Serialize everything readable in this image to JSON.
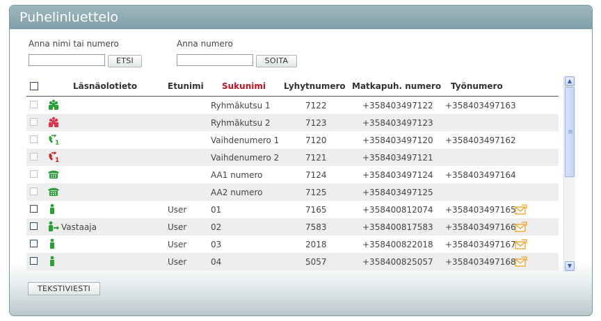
{
  "title": "Puhelinluettelo",
  "search": {
    "name_label": "Anna nimi tai numero",
    "name_value": "",
    "search_button": "ETSI",
    "number_label": "Anna numero",
    "number_value": "",
    "call_button": "SOITA"
  },
  "columns": {
    "presence": "Läsnäolotieto",
    "firstname": "Etunimi",
    "lastname": "Sukunimi",
    "short": "Lyhytnumero",
    "mobile": "Matkapuh. numero",
    "work": "Työnumero"
  },
  "rows": [
    {
      "icon": "group-icon",
      "icon_color": "#2aa136",
      "presence": "",
      "firstname": "",
      "lastname": "Ryhmäkutsu 1",
      "short": "7122",
      "mobile": "+358403497122",
      "work": "+358403497163",
      "checkbox_enabled": false,
      "mail": false
    },
    {
      "icon": "group-icon",
      "icon_color": "#e2334f",
      "presence": "",
      "firstname": "",
      "lastname": "Ryhmäkutsu 2",
      "short": "7123",
      "mobile": "+358403497123",
      "work": "",
      "checkbox_enabled": false,
      "mail": false
    },
    {
      "icon": "phone-handset-icon",
      "icon_color": "#2aa136",
      "presence": "",
      "firstname": "",
      "lastname": "Vaihdenumero 1",
      "short": "7120",
      "mobile": "+358403497120",
      "work": "+358403497162",
      "checkbox_enabled": false,
      "mail": false
    },
    {
      "icon": "phone-handset-icon",
      "icon_color": "#d11a1a",
      "presence": "",
      "firstname": "",
      "lastname": "Vaihdenumero 2",
      "short": "7121",
      "mobile": "+358403497121",
      "work": "",
      "checkbox_enabled": false,
      "mail": false
    },
    {
      "icon": "desk-phone-icon",
      "icon_color": "#2aa136",
      "presence": "",
      "firstname": "",
      "lastname": "AA1 numero",
      "short": "7124",
      "mobile": "+358403497124",
      "work": "+358403497164",
      "checkbox_enabled": false,
      "mail": false
    },
    {
      "icon": "desk-phone-icon",
      "icon_color": "#2aa136",
      "presence": "",
      "firstname": "",
      "lastname": "AA2 numero",
      "short": "7125",
      "mobile": "+358403497125",
      "work": "",
      "checkbox_enabled": false,
      "mail": false
    },
    {
      "icon": "person-icon",
      "icon_color": "#2aa136",
      "presence": "",
      "firstname": "User",
      "lastname": "01",
      "short": "7165",
      "mobile": "+358400812074",
      "work": "+358403497165",
      "checkbox_enabled": true,
      "mail": true
    },
    {
      "icon": "person-forward-icon",
      "icon_color": "#2aa136",
      "presence": "Vastaaja",
      "firstname": "User",
      "lastname": "02",
      "short": "7583",
      "mobile": "+358400817583",
      "work": "+358403497166",
      "checkbox_enabled": true,
      "mail": true
    },
    {
      "icon": "person-icon",
      "icon_color": "#2aa136",
      "presence": "",
      "firstname": "User",
      "lastname": "03",
      "short": "2018",
      "mobile": "+358400822018",
      "work": "+358403497167",
      "checkbox_enabled": true,
      "mail": true
    },
    {
      "icon": "person-icon",
      "icon_color": "#2aa136",
      "presence": "",
      "firstname": "User",
      "lastname": "04",
      "short": "5057",
      "mobile": "+358400825057",
      "work": "+358403497168",
      "checkbox_enabled": true,
      "mail": true
    }
  ],
  "sms_button": "TEKSTIVIESTI",
  "colors": {
    "accent": "#c1121f",
    "header_bar": "#8aa7af",
    "mail": "#f0a020"
  }
}
